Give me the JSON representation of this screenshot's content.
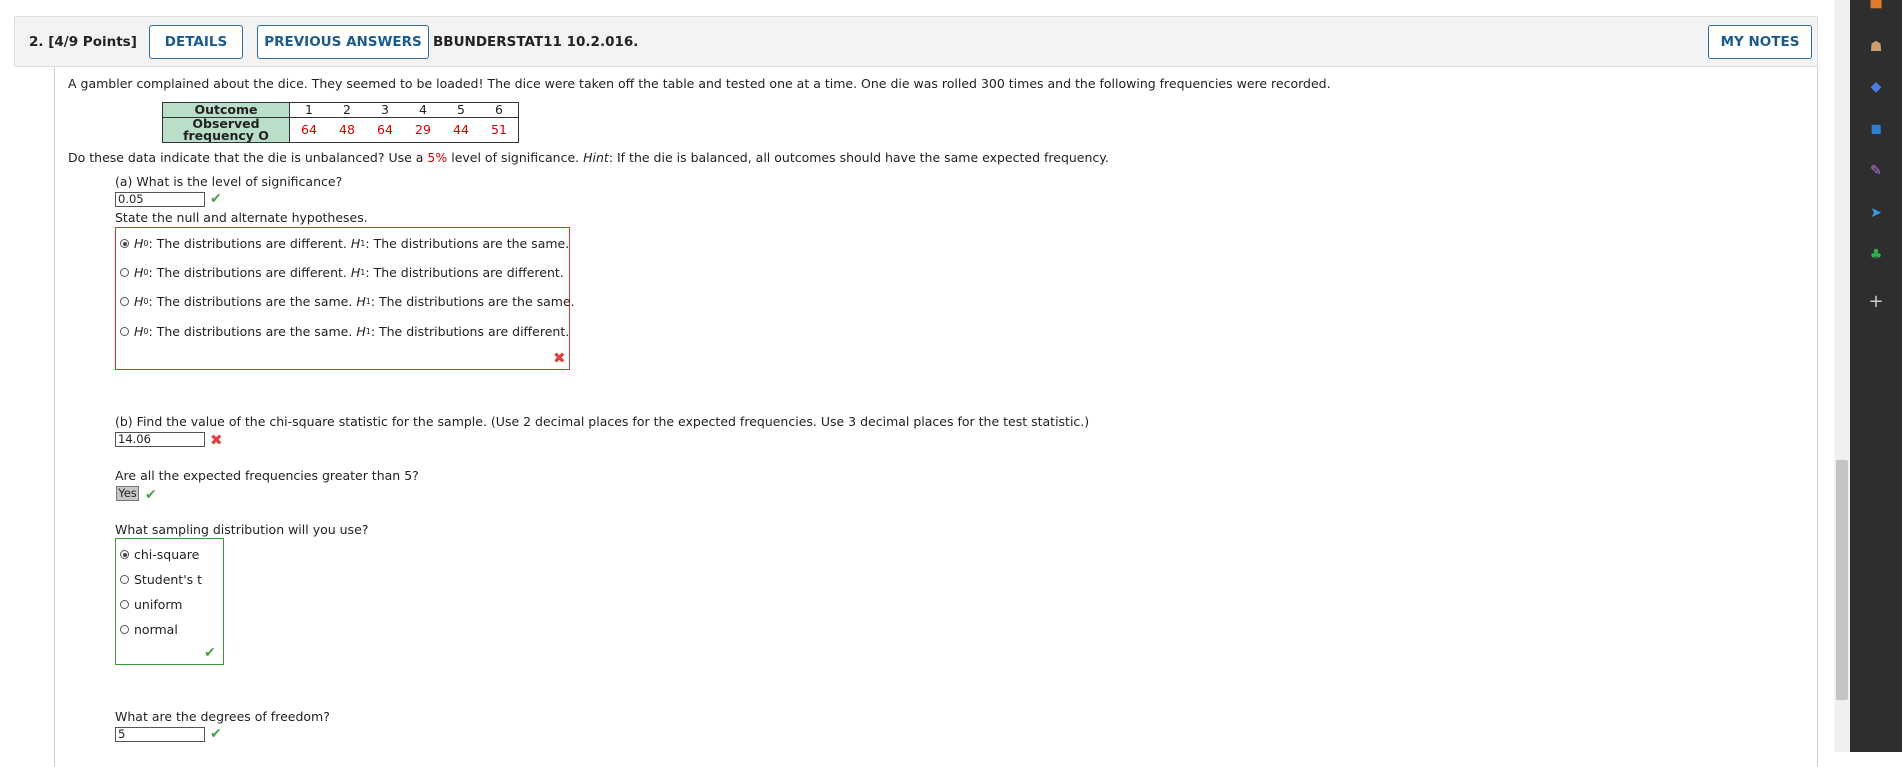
{
  "header": {
    "question_number": "2. [4/9 Points]",
    "details_label": "DETAILS",
    "previous_answers_label": "PREVIOUS ANSWERS",
    "code": "BBUNDERSTAT11 10.2.016.",
    "my_notes_label": "MY NOTES"
  },
  "problem": {
    "intro": "A gambler complained about the dice. They seemed to be loaded! The dice were taken off the table and tested one at a time. One die was rolled 300 times and the following frequencies were recorded.",
    "table": {
      "row1_header": "Outcome",
      "row2_header_line1": "Observed",
      "row2_header_line2": "frequency O",
      "outcomes": [
        "1",
        "2",
        "3",
        "4",
        "5",
        "6"
      ],
      "frequencies": [
        "64",
        "48",
        "64",
        "29",
        "44",
        "51"
      ]
    },
    "question_pre": "Do these data indicate that the die is unbalanced? Use a ",
    "significance": "5%",
    "question_mid": " level of significance. ",
    "hint_label": "Hint",
    "question_post": ": If the die is balanced, all outcomes should have the same expected frequency."
  },
  "part_a": {
    "prompt": "(a) What is the level of significance?",
    "answer": "0.05",
    "hypotheses_prompt": "State the null and alternate hypotheses.",
    "options": [
      {
        "h0": "The distributions are different.",
        "h1": "The distributions are the same.",
        "selected": true
      },
      {
        "h0": "The distributions are different.",
        "h1": "The distributions are different.",
        "selected": false
      },
      {
        "h0": "The distributions are the same.",
        "h1": "The distributions are the same.",
        "selected": false
      },
      {
        "h0": "The distributions are the same.",
        "h1": "The distributions are different.",
        "selected": false
      }
    ]
  },
  "part_b": {
    "prompt": "(b) Find the value of the chi-square statistic for the sample. (Use 2 decimal places for the expected frequencies. Use 3 decimal places for the test statistic.)",
    "answer": "14.06",
    "expected_prompt": "Are all the expected frequencies greater than 5?",
    "expected_answer": "Yes",
    "distribution_prompt": "What sampling distribution will you use?",
    "distribution_options": [
      "chi-square",
      "Student's t",
      "uniform",
      "normal"
    ],
    "df_prompt": "What are the degrees of freedom?",
    "df_answer": "5"
  },
  "icons": {
    "check": "check-icon",
    "cross": "cross-icon"
  },
  "colors": {
    "correct": "#4aa04a",
    "incorrect": "#e04040",
    "table_header": "#b9dfc9",
    "link_blue": "#1d5a8c"
  }
}
